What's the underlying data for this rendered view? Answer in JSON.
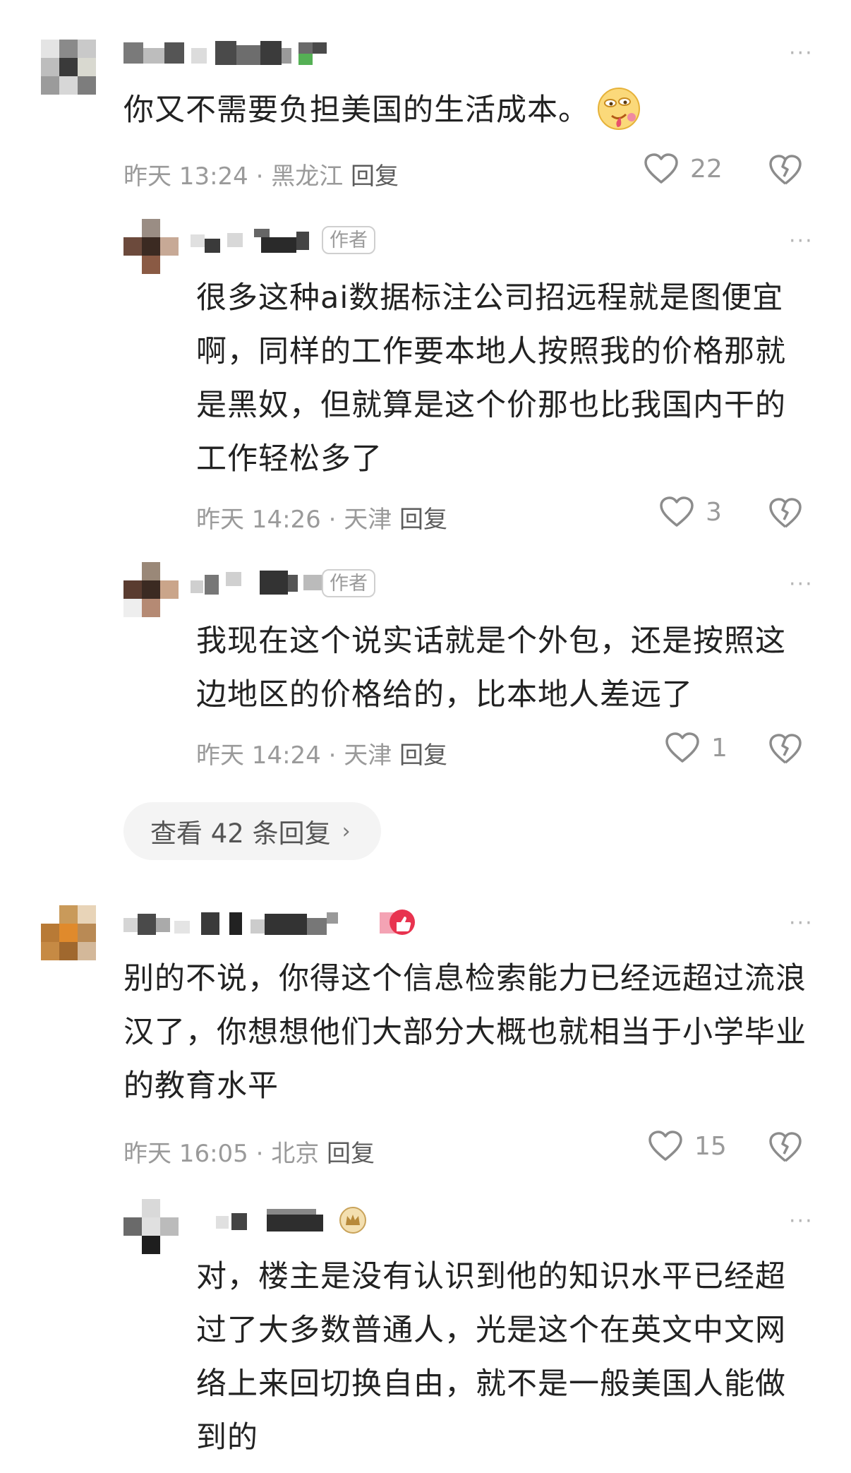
{
  "comments": [
    {
      "text": "你又不需要负担美国的生活成本。",
      "emoji": "drooling-face-emoji",
      "meta": {
        "time": "昨天 13:24",
        "location": "黑龙江",
        "reply": "回复"
      },
      "likes": "22"
    },
    {
      "text": "很多这种ai数据标注公司招远程就是图便宜\n啊，同样的工作要本地人按照我的价格那就\n是黑奴，但就算是这个价那也比我国内干的\n工作轻松多了",
      "author_tag": "作者",
      "meta": {
        "time": "昨天 14:26",
        "location": "天津",
        "reply": "回复"
      },
      "likes": "3"
    },
    {
      "text": "我现在这个说实话就是个外包，还是按照这\n边地区的价格给的，比本地人差远了",
      "author_tag": "作者",
      "meta": {
        "time": "昨天 14:24",
        "location": "天津",
        "reply": "回复"
      },
      "likes": "1"
    },
    {
      "text": "别的不说，你得这个信息检索能力已经远超过流浪\n汉了，你想想他们大部分大概也就相当于小学毕业\n的教育水平",
      "meta": {
        "time": "昨天 16:05",
        "location": "北京",
        "reply": "回复"
      },
      "likes": "15"
    },
    {
      "text": "对，楼主是没有认识到他的知识水平已经超\n过了大多数普通人，光是这个在英文中文网\n络上来回切换自由，就不是一般美国人能做\n到的"
    }
  ],
  "view_replies": {
    "label": "查看 42 条回复",
    "chevron": "›"
  },
  "more_label": "···",
  "colors": {
    "meta": "#9a9a9a",
    "text": "#222222",
    "pill": "#f4f4f4"
  }
}
